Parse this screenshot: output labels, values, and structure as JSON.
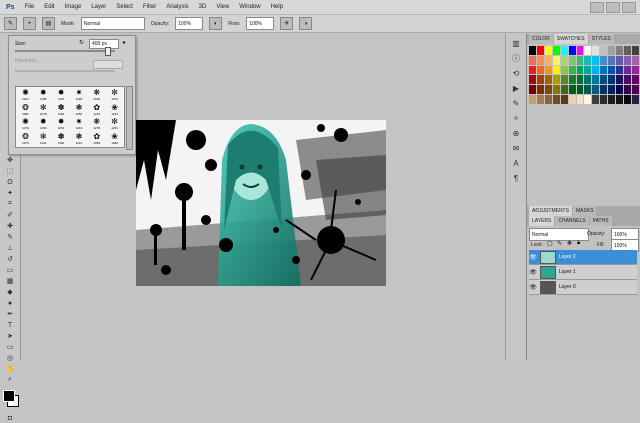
{
  "menu": {
    "logo": "Ps",
    "items": [
      "File",
      "Edit",
      "Image",
      "Layer",
      "Select",
      "Filter",
      "Analysis",
      "3D",
      "View",
      "Window",
      "Help"
    ]
  },
  "options": {
    "mode_label": "Mode:",
    "mode_value": "Normal",
    "opacity_label": "Opacity:",
    "opacity_value": "100%",
    "flow_label": "Flow:",
    "flow_value": "100%"
  },
  "brush_panel": {
    "size_label": "Size:",
    "size_value": "400 px",
    "hardness_label": "Hardness:",
    "sizes": [
      "1222",
      "1185",
      "1107",
      "1148",
      "1230",
      "1075",
      "1081",
      "1078",
      "1182",
      "1156",
      "1231",
      "1231",
      "1079",
      "1153",
      "1263",
      "1219",
      "1276",
      "1251",
      "1276",
      "1141",
      "1181",
      "1131",
      "1099",
      "1062"
    ]
  },
  "right_panel": {
    "top_tabs": [
      "COLOR",
      "SWATCHES",
      "STYLES"
    ],
    "adj_tabs": [
      "ADJUSTMENTS",
      "MASKS"
    ],
    "layer_tabs": [
      "LAYERS",
      "CHANNELS",
      "PATHS"
    ],
    "blend_mode": "Normal",
    "opacity_label": "Opacity:",
    "opacity_value": "100%",
    "lock_label": "Lock:",
    "fill_label": "Fill:",
    "fill_value": "100%",
    "layers": [
      "Layer 2",
      "Layer 1",
      "Layer 0"
    ],
    "swatch_colors": [
      "#000000",
      "#ff0000",
      "#ffff00",
      "#00ff00",
      "#00ffff",
      "#0000ff",
      "#ff00ff",
      "#ffffff",
      "#e0e0e0",
      "#c0c0c0",
      "#a0a0a0",
      "#808080",
      "#606060",
      "#404040",
      "#f26c4f",
      "#f68e55",
      "#fbaf5c",
      "#fff467",
      "#acd372",
      "#7cc576",
      "#3bb878",
      "#1abbb4",
      "#00bff3",
      "#438ccb",
      "#5574b9",
      "#605ca8",
      "#855fa8",
      "#a763a8",
      "#ed1c24",
      "#f26522",
      "#f7941d",
      "#fff200",
      "#8dc73f",
      "#39b54a",
      "#00a651",
      "#00a99d",
      "#00aeef",
      "#0072bc",
      "#0054a6",
      "#2e3192",
      "#662d91",
      "#92278f",
      "#9e0b0f",
      "#a0410d",
      "#a36209",
      "#aba000",
      "#598527",
      "#1a7b30",
      "#007236",
      "#00746b",
      "#0076a3",
      "#004b80",
      "#003471",
      "#1b1464",
      "#440e62",
      "#630460",
      "#790000",
      "#7b2e00",
      "#7d4900",
      "#827b00",
      "#406618",
      "#005e20",
      "#005826",
      "#005952",
      "#005b7f",
      "#003663",
      "#002157",
      "#0d004c",
      "#32004b",
      "#4b0049",
      "#c69c6d",
      "#a67c52",
      "#8c6239",
      "#754c24",
      "#603913",
      "#e6d0b8",
      "#f5e0c6",
      "#fff6e6",
      "#3d3d3d",
      "#2b2b2b",
      "#1f1f1f",
      "#151515",
      "#0a0a0a",
      "#202040"
    ]
  }
}
